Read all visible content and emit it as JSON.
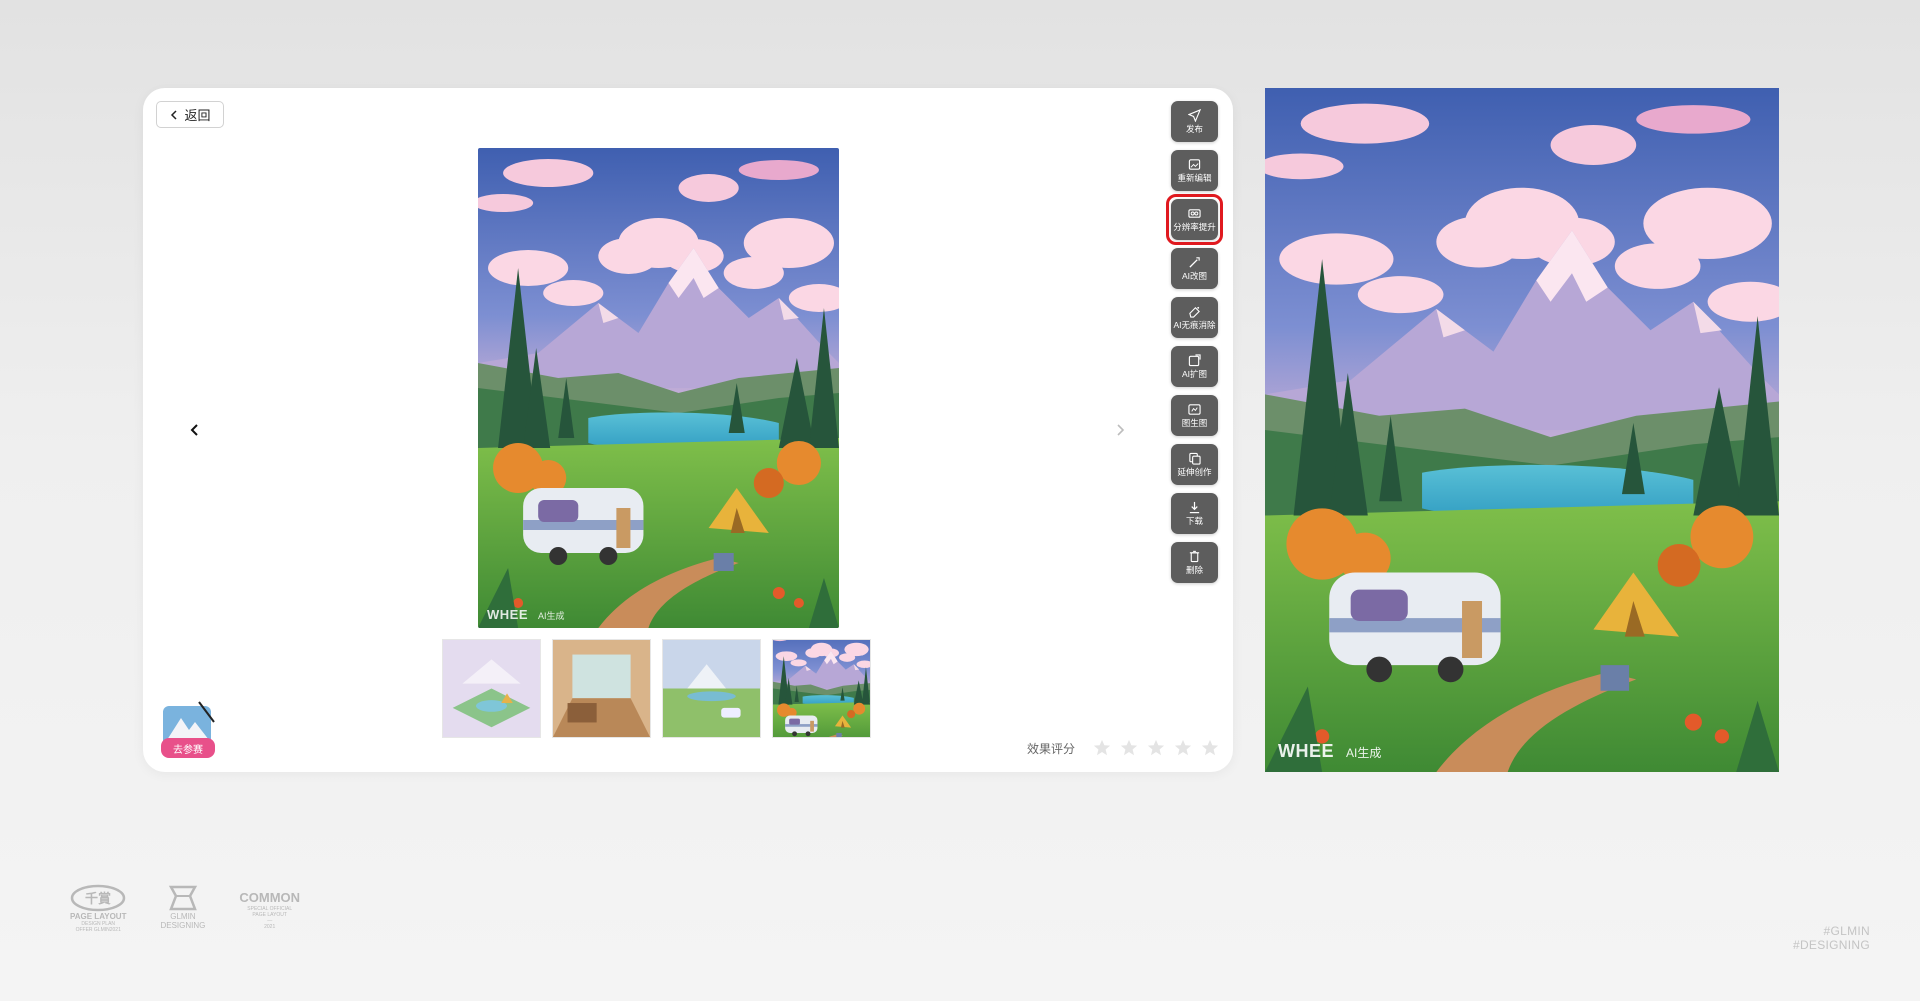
{
  "header": {
    "back_label": "返回"
  },
  "main_image": {
    "watermark_brand": "WHEE",
    "watermark_sub": "AI生成"
  },
  "preview_image": {
    "watermark_brand": "WHEE",
    "watermark_sub": "AI生成"
  },
  "toolbar": {
    "items": [
      {
        "label": "发布",
        "icon": "send-icon"
      },
      {
        "label": "重新编辑",
        "icon": "image-edit-icon"
      },
      {
        "label": "分辨率提升",
        "icon": "hd-icon",
        "highlighted": true
      },
      {
        "label": "AI改图",
        "icon": "magic-brush-icon"
      },
      {
        "label": "AI无痕消除",
        "icon": "eraser-icon"
      },
      {
        "label": "AI扩图",
        "icon": "expand-icon"
      },
      {
        "label": "图生图",
        "icon": "image-to-image-icon"
      },
      {
        "label": "延伸创作",
        "icon": "copy-icon"
      },
      {
        "label": "下载",
        "icon": "download-icon"
      },
      {
        "label": "删除",
        "icon": "trash-icon"
      }
    ],
    "highlight_color": "#e0191f"
  },
  "thumbnails": [
    "isometric-camp",
    "cozy-room",
    "camping-valley",
    "mountain-caravan"
  ],
  "rating": {
    "label": "效果评分",
    "stars": 5,
    "value": 0
  },
  "contest_badge": {
    "label": "去参赛"
  },
  "footer": {
    "logo1": {
      "mark": "千賞",
      "title": "PAGE LAYOUT",
      "line1": "DESIGN PLAN",
      "line2": "OFFER GLMIN2021"
    },
    "logo2": {
      "title": "GLMIN",
      "line1": "DESIGNING"
    },
    "logo3": {
      "title": "COMMON",
      "line1": "SPECIAL OFFICIAL",
      "line2": "PAGE LAYOUT",
      "line3": "—",
      "line4": "2021"
    },
    "tags": [
      "#GLMIN",
      "#DESIGNING"
    ]
  },
  "colors": {
    "tool_bg": "#5d5d5d",
    "panel_bg": "#ffffff"
  }
}
